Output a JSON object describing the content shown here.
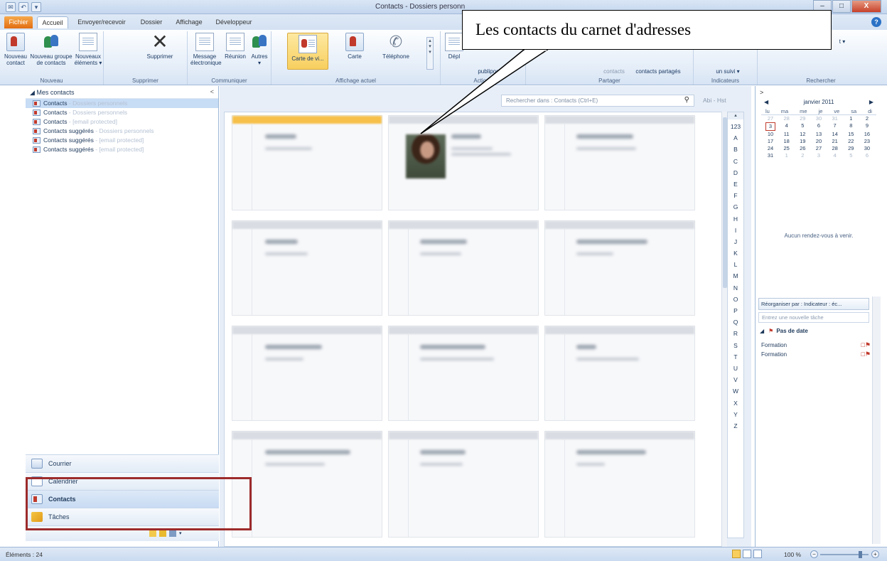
{
  "window": {
    "title": "Contacts - Dossiers personn",
    "quick_access": [
      "✉",
      "↶",
      "▾"
    ],
    "controls": [
      "–",
      "□",
      "X"
    ]
  },
  "tabs": {
    "fichier": "Fichier",
    "items": [
      "Accueil",
      "Envoyer/recevoir",
      "Dossier",
      "Affichage",
      "Développeur"
    ],
    "help": "?"
  },
  "ribbon": {
    "nouveau": {
      "label": "Nouveau",
      "nouveau_contact": [
        "Nouveau",
        "contact"
      ],
      "nouveau_groupe": [
        "Nouveau groupe",
        "de contacts"
      ],
      "nouveaux_elements": [
        "Nouveaux",
        "éléments ▾"
      ]
    },
    "supprimer": {
      "label": "Supprimer",
      "button": "Supprimer"
    },
    "communiquer": {
      "label": "Communiquer",
      "message": [
        "Message",
        "électronique"
      ],
      "reunion": "Réunion",
      "autres": [
        "Autres",
        "▾"
      ]
    },
    "affichage": {
      "label": "Affichage actuel",
      "carte_visite": "Carte de vi...",
      "carte": "Carte",
      "telephone": "Téléphone"
    },
    "actions": {
      "label": "Actions",
      "depl": "Dépl",
      "publipostage": "publipostage"
    },
    "partager": {
      "label": "Partager",
      "item1": "contacts",
      "item2": "contacts partagés"
    },
    "indicateurs": {
      "label": "Indicateurs",
      "item": "un suivi ▾"
    },
    "rechercher": {
      "label": "Rechercher",
      "item": "t ▾"
    }
  },
  "navpane": {
    "header": "◢ Mes contacts",
    "collapse": "<",
    "folders": [
      {
        "name": "Contacts",
        "sub": "- Dossiers personnels"
      },
      {
        "name": "Contacts",
        "sub": "- Dossiers personnels"
      },
      {
        "name": "Contacts",
        "sub": "- [email protected]"
      },
      {
        "name": "Contacts suggérés",
        "sub": "- Dossiers personnels"
      },
      {
        "name": "Contacts suggérés",
        "sub": "- [email protected]"
      },
      {
        "name": "Contacts suggérés",
        "sub": "- [email protected]"
      }
    ],
    "buttons": [
      "Courrier",
      "Calendrier",
      "Contacts",
      "Tâches"
    ]
  },
  "main": {
    "search_placeholder": "Rechercher dans : Contacts (Ctrl+E)",
    "search_icon": "⚲",
    "abc": "Abi - Hst",
    "alpha_index": [
      "123",
      "A",
      "B",
      "C",
      "D",
      "E",
      "F",
      "G",
      "H",
      "I",
      "J",
      "K",
      "L",
      "M",
      "N",
      "O",
      "P",
      "Q",
      "R",
      "S",
      "T",
      "U",
      "V",
      "W",
      "X",
      "Y",
      "Z"
    ],
    "contact_cards_count": 12
  },
  "todobar": {
    "expander": ">",
    "calendar": {
      "month": "janvier 2011",
      "prev": "◀",
      "next": "▶",
      "dows": [
        "lu",
        "ma",
        "me",
        "je",
        "ve",
        "sa",
        "di"
      ],
      "weeks": [
        [
          "27",
          "28",
          "29",
          "30",
          "31",
          "1",
          "2"
        ],
        [
          "3",
          "4",
          "5",
          "6",
          "7",
          "8",
          "9"
        ],
        [
          "10",
          "11",
          "12",
          "13",
          "14",
          "15",
          "16"
        ],
        [
          "17",
          "18",
          "19",
          "20",
          "21",
          "22",
          "23"
        ],
        [
          "24",
          "25",
          "26",
          "27",
          "28",
          "29",
          "30"
        ],
        [
          "31",
          "1",
          "2",
          "3",
          "4",
          "5",
          "6"
        ]
      ],
      "today": "3"
    },
    "no_appointments": "Aucun rendez-vous à venir.",
    "task_header": "Réorganiser par : Indicateur : éc...",
    "task_input": "Entrez une nouvelle tâche",
    "group_label": "Pas de date",
    "tasks": [
      "Formation",
      "Formation"
    ]
  },
  "statusbar": {
    "items": "Éléments : 24",
    "zoom": "100 %",
    "zoom_level": 0.82
  },
  "annotation": {
    "callout": "Les contacts du carnet d'adresses"
  }
}
